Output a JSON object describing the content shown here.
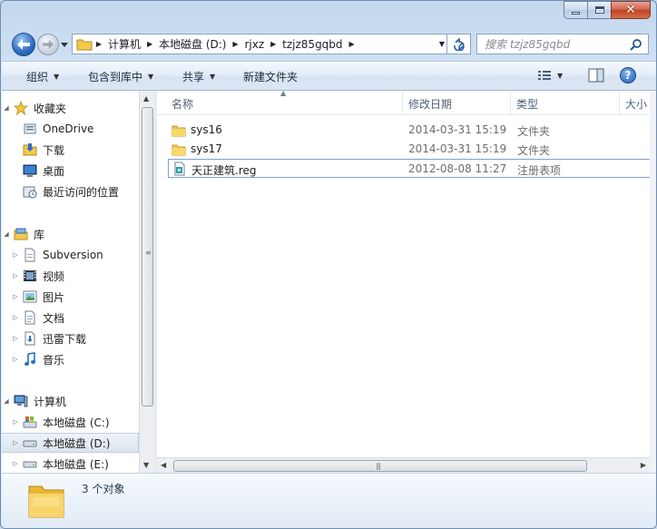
{
  "window": {
    "caption": {
      "minimize": "minimize",
      "maximize": "maximize",
      "close": "close"
    }
  },
  "address": {
    "crumbs": [
      "计算机",
      "本地磁盘 (D:)",
      "rjxz",
      "tzjz85gqbd"
    ]
  },
  "search": {
    "placeholder": "搜索 tzjz85gqbd"
  },
  "toolbar": {
    "organize": "组织",
    "include_in_library": "包含到库中",
    "share": "共享",
    "new_folder": "新建文件夹"
  },
  "nav": {
    "favorites": {
      "label": "收藏夹",
      "items": [
        "OneDrive",
        "下载",
        "桌面",
        "最近访问的位置"
      ]
    },
    "libraries": {
      "label": "库",
      "items": [
        "Subversion",
        "视频",
        "图片",
        "文档",
        "迅雷下载",
        "音乐"
      ]
    },
    "computer": {
      "label": "计算机",
      "items": [
        "本地磁盘 (C:)",
        "本地磁盘 (D:)",
        "本地磁盘 (E:)"
      ],
      "selected": "本地磁盘 (D:)"
    }
  },
  "columns": {
    "name": "名称",
    "modified": "修改日期",
    "type": "类型",
    "size": "大小"
  },
  "files": [
    {
      "name": "sys16",
      "modified": "2014-03-31 15:19",
      "type": "文件夹",
      "icon": "folder-icon"
    },
    {
      "name": "sys17",
      "modified": "2014-03-31 15:19",
      "type": "文件夹",
      "icon": "folder-icon"
    },
    {
      "name": "天正建筑.reg",
      "modified": "2012-08-08 11:27",
      "type": "注册表项",
      "icon": "registry-file-icon"
    }
  ],
  "details": {
    "count": "3 个对象"
  },
  "colors": {
    "accent": "#2d6cc0",
    "folder": "#f2c94c",
    "selection_border": "#7da2ce"
  }
}
